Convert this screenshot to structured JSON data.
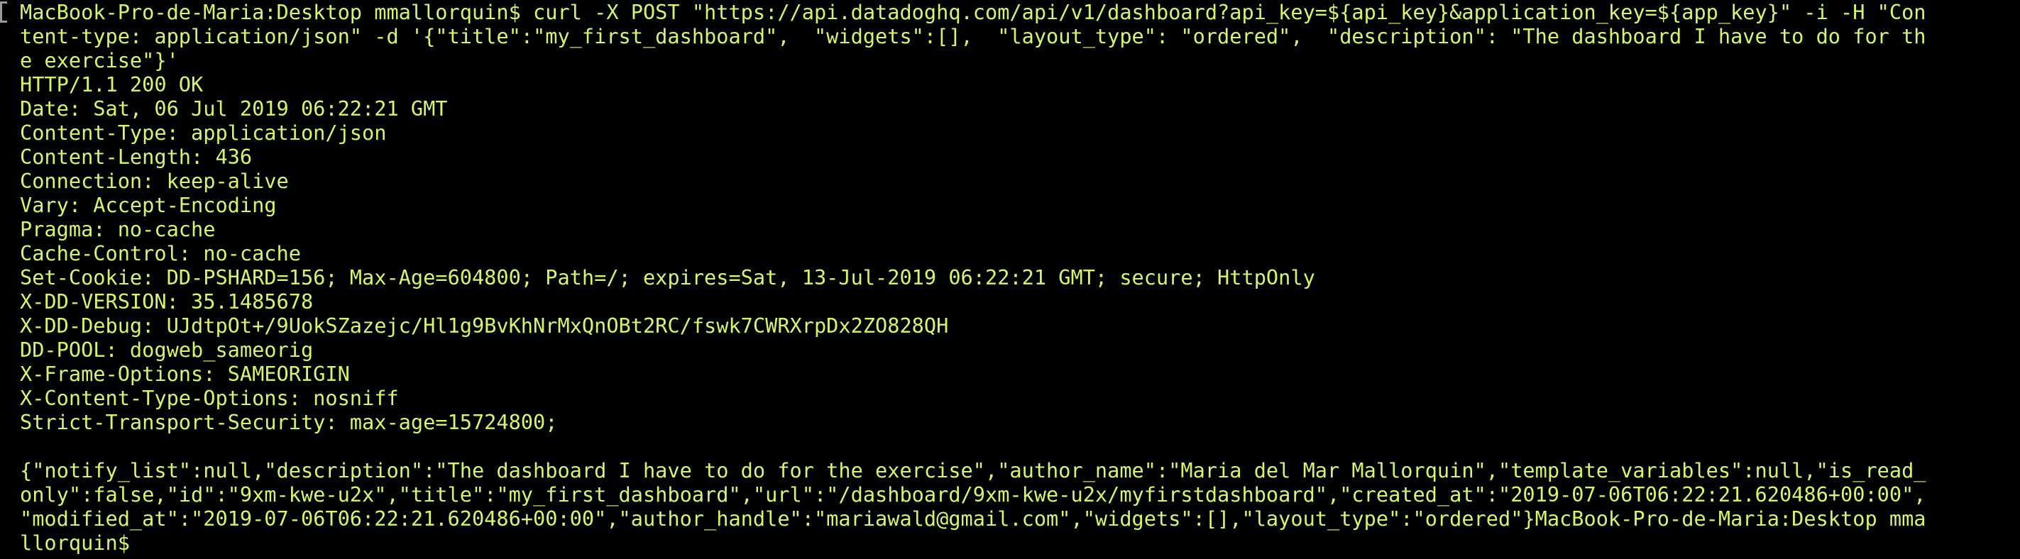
{
  "terminal": {
    "text_color": "#d6f46e",
    "background": "#000000",
    "lines": [
      "MacBook-Pro-de-Maria:Desktop mmallorquin$ curl -X POST \"https://api.datadoghq.com/api/v1/dashboard?api_key=${api_key}&application_key=${app_key}\" -i -H \"Con",
      "tent-type: application/json\" -d '{\"title\":\"my_first_dashboard\",  \"widgets\":[],  \"layout_type\": \"ordered\",  \"description\": \"The dashboard I have to do for th",
      "e exercise\"}'",
      "HTTP/1.1 200 OK",
      "Date: Sat, 06 Jul 2019 06:22:21 GMT",
      "Content-Type: application/json",
      "Content-Length: 436",
      "Connection: keep-alive",
      "Vary: Accept-Encoding",
      "Pragma: no-cache",
      "Cache-Control: no-cache",
      "Set-Cookie: DD-PSHARD=156; Max-Age=604800; Path=/; expires=Sat, 13-Jul-2019 06:22:21 GMT; secure; HttpOnly",
      "X-DD-VERSION: 35.1485678",
      "X-DD-Debug: UJdtpOt+/9UokSZazejc/Hl1g9BvKhNrMxQnOBt2RC/fswk7CWRXrpDx2ZO828QH",
      "DD-POOL: dogweb_sameorig",
      "X-Frame-Options: SAMEORIGIN",
      "X-Content-Type-Options: nosniff",
      "Strict-Transport-Security: max-age=15724800;",
      "",
      "{\"notify_list\":null,\"description\":\"The dashboard I have to do for the exercise\",\"author_name\":\"Maria del Mar Mallorquin\",\"template_variables\":null,\"is_read_",
      "only\":false,\"id\":\"9xm-kwe-u2x\",\"title\":\"my_first_dashboard\",\"url\":\"/dashboard/9xm-kwe-u2x/myfirstdashboard\",\"created_at\":\"2019-07-06T06:22:21.620486+00:00\",",
      "\"modified_at\":\"2019-07-06T06:22:21.620486+00:00\",\"author_handle\":\"mariawald@gmail.com\",\"widgets\":[],\"layout_type\":\"ordered\"}MacBook-Pro-de-Maria:Desktop mma",
      "llorquin$"
    ]
  }
}
